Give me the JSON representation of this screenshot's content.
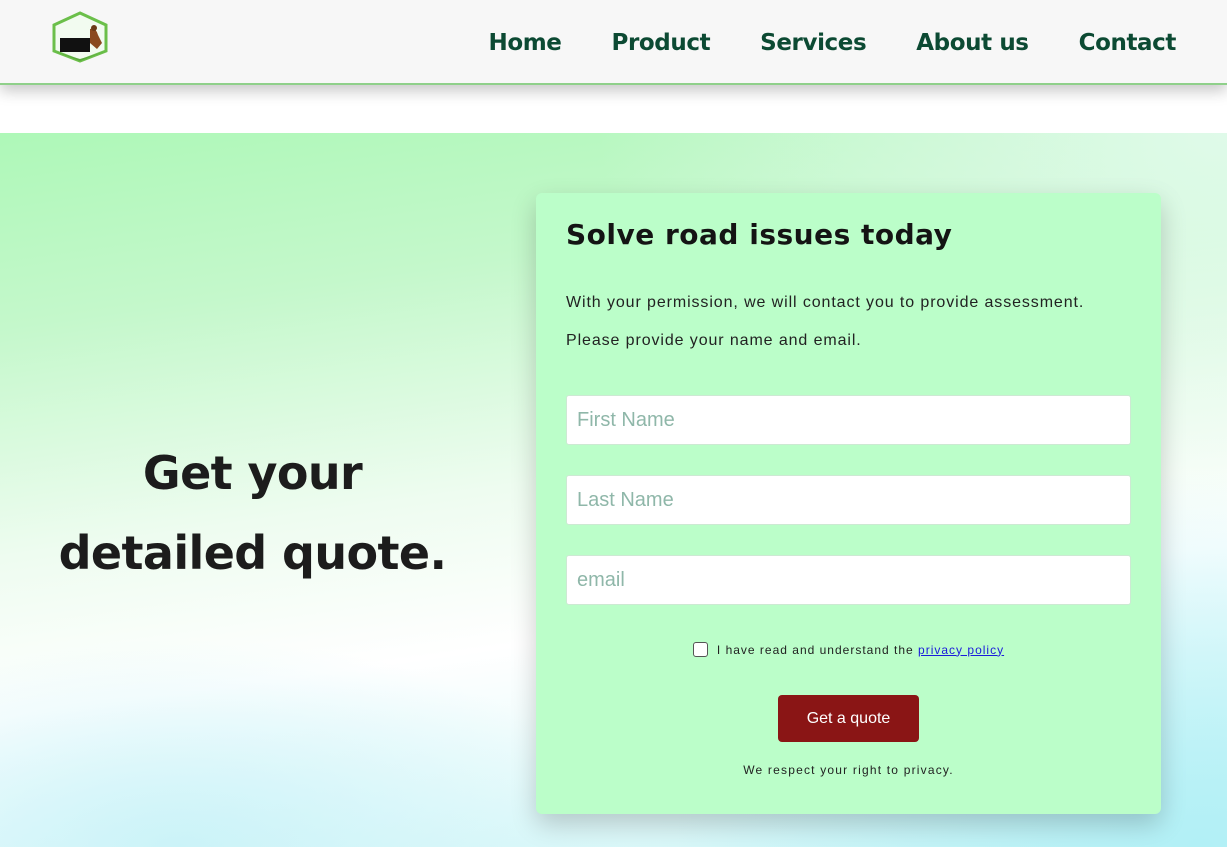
{
  "nav": {
    "logo_alt": "road repair logo",
    "links": [
      "Home",
      "Product",
      "Services",
      "About us",
      "Contact"
    ]
  },
  "hero": {
    "heading_line1": "Get your",
    "heading_line2": "detailed quote."
  },
  "form": {
    "title": "Solve road issues today",
    "intro_line1": "With your permission, we will contact you to provide assessment.",
    "intro_line2": "Please provide your name and email.",
    "first_name_placeholder": "First Name",
    "last_name_placeholder": "Last Name",
    "email_placeholder": "email",
    "consent_text": "I have read and understand the",
    "consent_link": "privacy policy",
    "consent_checked": false,
    "submit_label": "Get a quote",
    "privacy_note": "We respect your right to privacy."
  },
  "colors": {
    "nav_text": "#0c4a33",
    "card_bg": "#bbfec9",
    "button_bg": "#8a1515",
    "link": "#1a1adb",
    "logo_green": "#6bbf4a"
  }
}
